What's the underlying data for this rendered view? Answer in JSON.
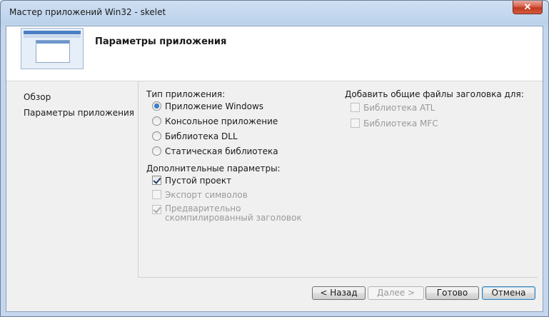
{
  "window": {
    "title": "Мастер приложений Win32 - skelet",
    "close_label": "✕"
  },
  "header": {
    "title": "Параметры приложения"
  },
  "nav": {
    "items": [
      {
        "label": "Обзор"
      },
      {
        "label": "Параметры приложения"
      }
    ]
  },
  "app_type": {
    "label": "Тип приложения:",
    "options": [
      {
        "label": "Приложение Windows",
        "selected": true
      },
      {
        "label": "Консольное приложение",
        "selected": false
      },
      {
        "label": "Библиотека DLL",
        "selected": false
      },
      {
        "label": "Статическая библиотека",
        "selected": false
      }
    ]
  },
  "extra": {
    "label": "Дополнительные параметры:",
    "options": [
      {
        "label": "Пустой проект",
        "checked": true,
        "enabled": true
      },
      {
        "label": "Экспорт символов",
        "checked": false,
        "enabled": false
      },
      {
        "label": "Предварительно скомпилированный заголовок",
        "checked": true,
        "enabled": false
      }
    ]
  },
  "headers": {
    "label": "Добавить общие файлы заголовка для:",
    "options": [
      {
        "label": "Библиотека ATL",
        "checked": false,
        "enabled": false
      },
      {
        "label": "Библиотека MFC",
        "checked": false,
        "enabled": false
      }
    ]
  },
  "buttons": {
    "back": "< Назад",
    "next": "Далее >",
    "finish": "Готово",
    "cancel": "Отмена"
  }
}
